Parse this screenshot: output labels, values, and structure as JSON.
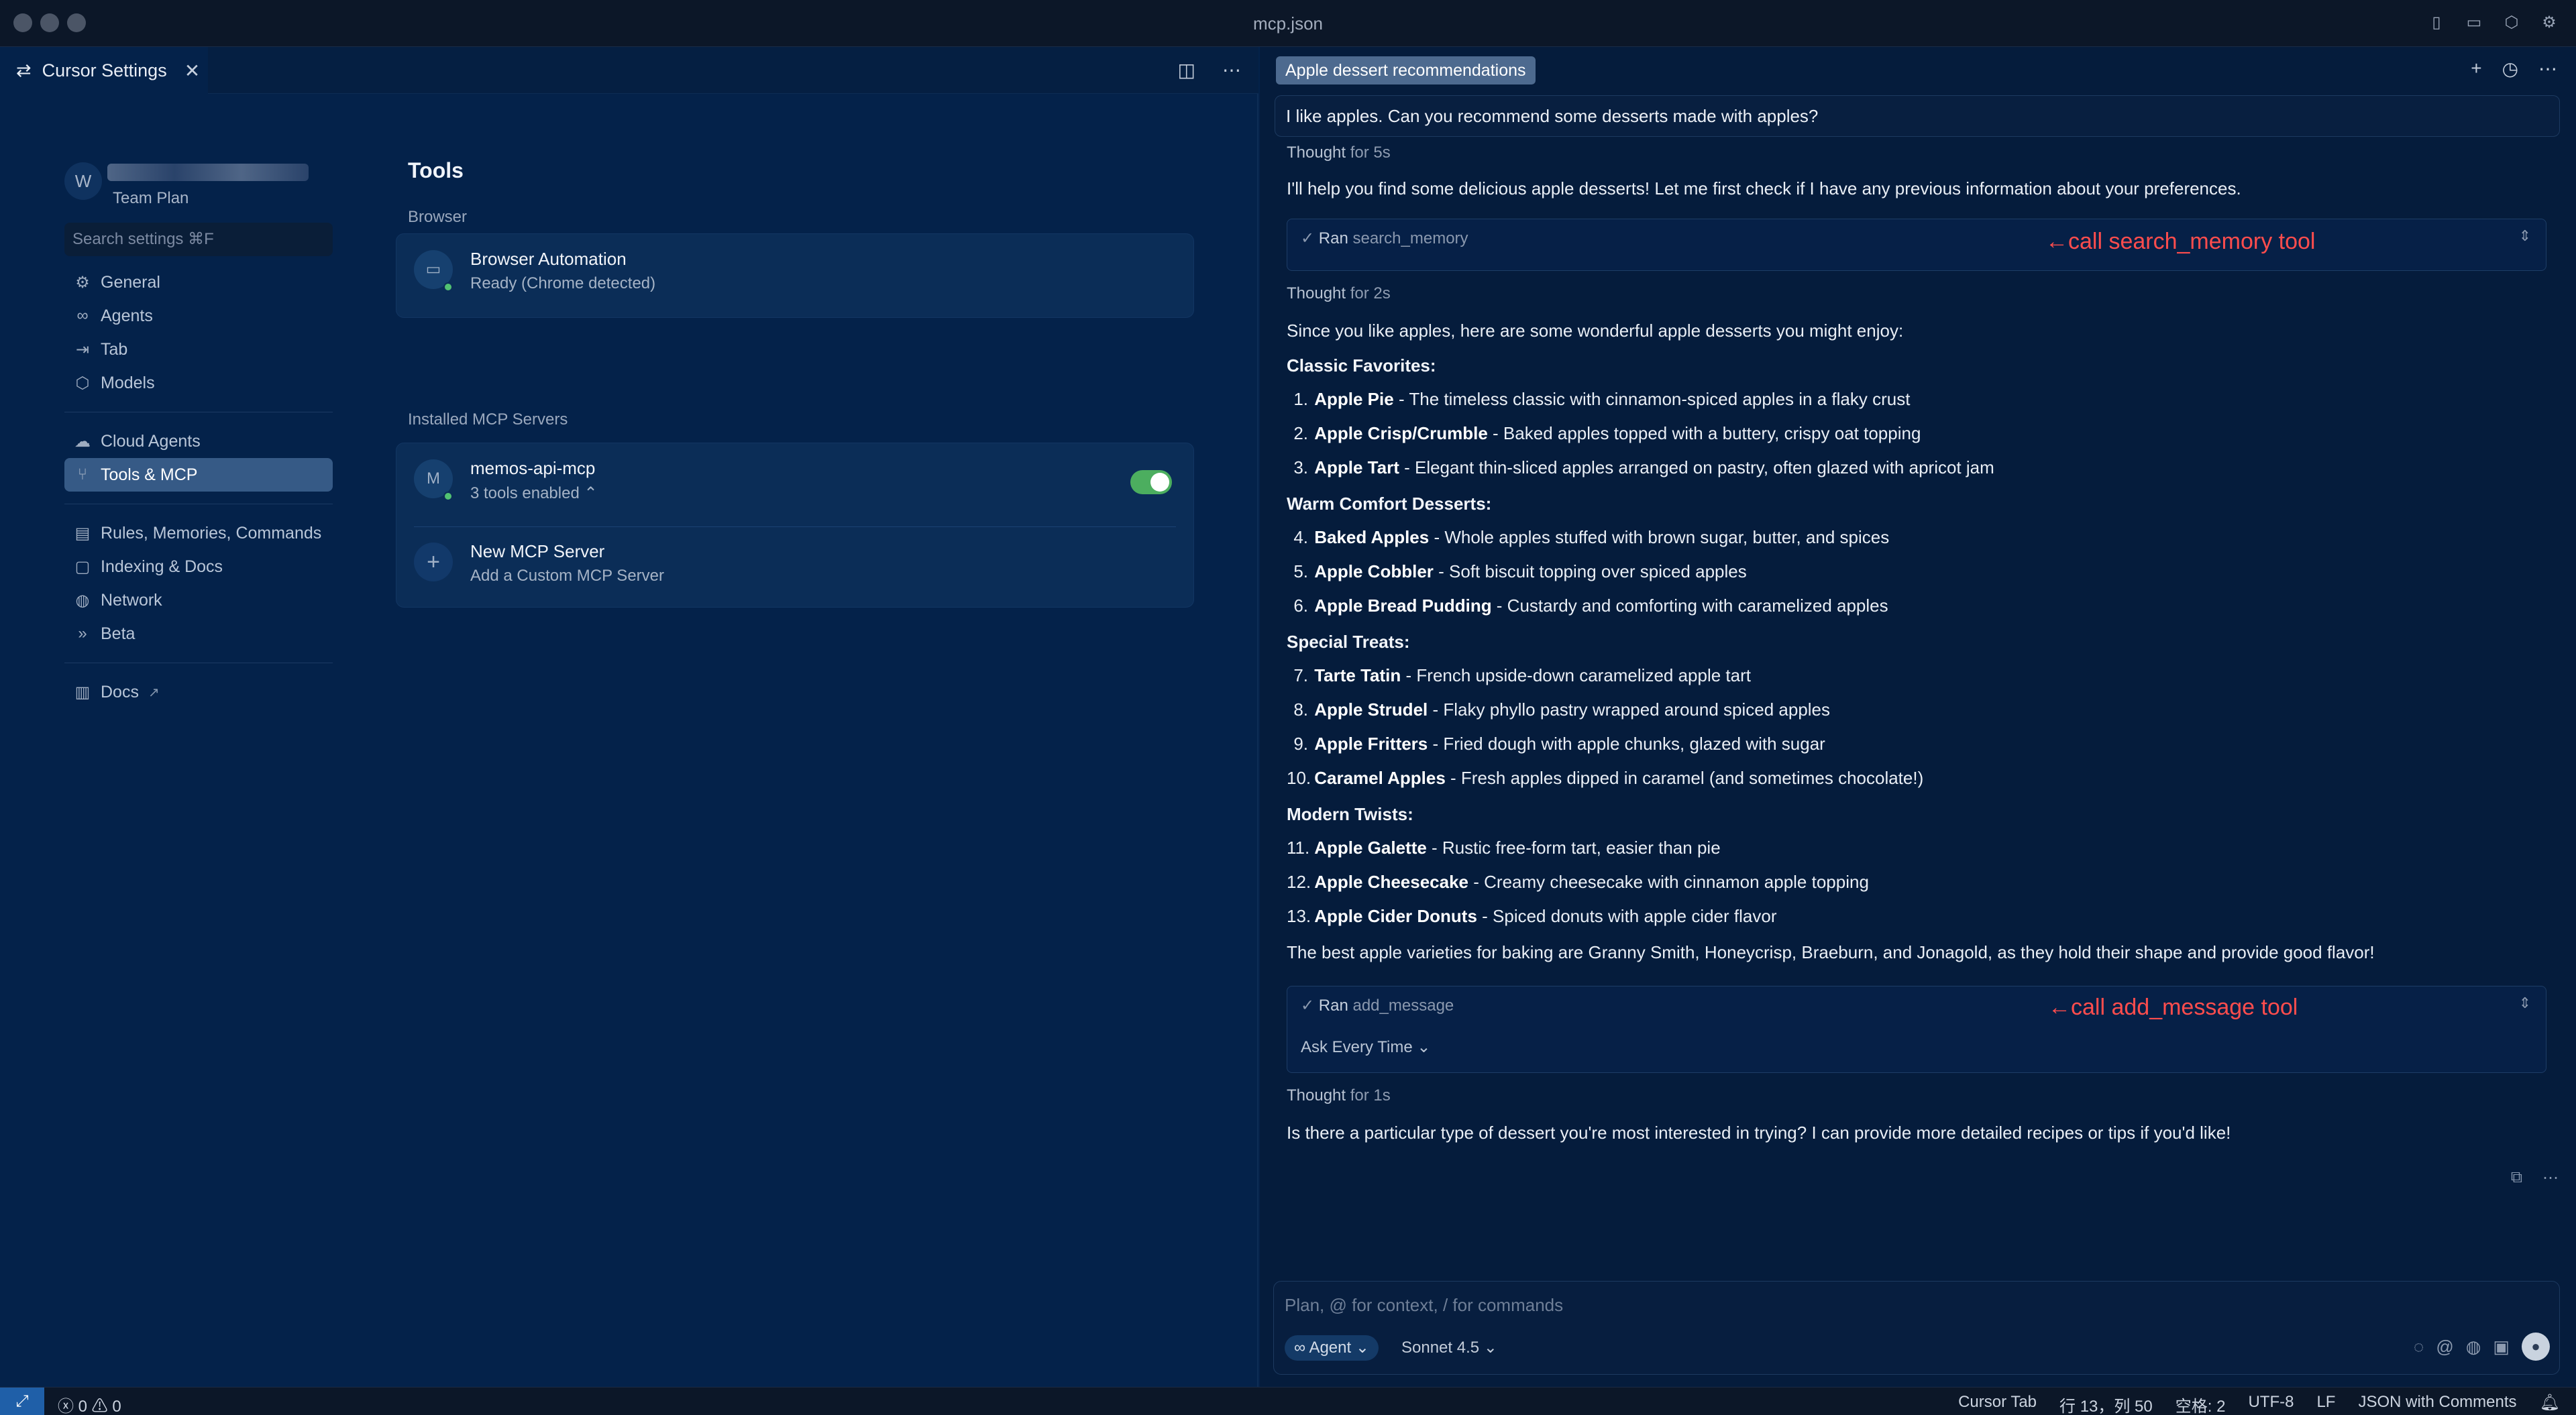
{
  "window": {
    "title": "mcp.json"
  },
  "left_tab": {
    "title": "Cursor Settings"
  },
  "user": {
    "initial": "W",
    "plan": "Team Plan"
  },
  "search": {
    "placeholder": "Search settings ⌘F"
  },
  "nav": {
    "group1": [
      "General",
      "Agents",
      "Tab",
      "Models"
    ],
    "group2": [
      "Cloud Agents",
      "Tools & MCP"
    ],
    "group3": [
      "Rules, Memories, Commands",
      "Indexing & Docs",
      "Network",
      "Beta"
    ],
    "group4": [
      "Docs"
    ]
  },
  "tools": {
    "title": "Tools",
    "browser_label": "Browser",
    "browser": {
      "name": "Browser Automation",
      "status": "Ready (Chrome detected)"
    },
    "installed_label": "Installed MCP Servers",
    "server": {
      "initial": "M",
      "name": "memos-api-mcp",
      "status": "3 tools enabled",
      "enabled": true
    },
    "new_server": {
      "name": "New MCP Server",
      "sub": "Add a Custom MCP Server"
    }
  },
  "chat": {
    "tab_title": "Apple dessert recommendations",
    "user_message": "I like apples. Can you recommend some desserts made with apples?",
    "thought1": {
      "label": "Thought",
      "time": "for 5s"
    },
    "intro": "I'll help you find some delicious apple desserts! Let me first check if I have any previous information about your preferences.",
    "tool1": {
      "ran": "Ran",
      "name": "search_memory",
      "annotation": "←call search_memory tool"
    },
    "thought2": {
      "label": "Thought",
      "time": "for 2s"
    },
    "lead": "Since you like apples, here are some wonderful apple desserts you might enjoy:",
    "sections": [
      {
        "heading": "Classic Favorites:",
        "items": [
          {
            "n": "1.",
            "name": "Apple Pie",
            "desc": " - The timeless classic with cinnamon-spiced apples in a flaky crust"
          },
          {
            "n": "2.",
            "name": "Apple Crisp/Crumble",
            "desc": " - Baked apples topped with a buttery, crispy oat topping"
          },
          {
            "n": "3.",
            "name": "Apple Tart",
            "desc": " - Elegant thin-sliced apples arranged on pastry, often glazed with apricot jam"
          }
        ]
      },
      {
        "heading": "Warm Comfort Desserts:",
        "items": [
          {
            "n": "4.",
            "name": "Baked Apples",
            "desc": " - Whole apples stuffed with brown sugar, butter, and spices"
          },
          {
            "n": "5.",
            "name": "Apple Cobbler",
            "desc": " - Soft biscuit topping over spiced apples"
          },
          {
            "n": "6.",
            "name": "Apple Bread Pudding",
            "desc": " - Custardy and comforting with caramelized apples"
          }
        ]
      },
      {
        "heading": "Special Treats:",
        "items": [
          {
            "n": "7.",
            "name": "Tarte Tatin",
            "desc": " - French upside-down caramelized apple tart"
          },
          {
            "n": "8.",
            "name": "Apple Strudel",
            "desc": " - Flaky phyllo pastry wrapped around spiced apples"
          },
          {
            "n": "9.",
            "name": "Apple Fritters",
            "desc": " - Fried dough with apple chunks, glazed with sugar"
          },
          {
            "n": "10.",
            "name": "Caramel Apples",
            "desc": " - Fresh apples dipped in caramel (and sometimes chocolate!)"
          }
        ]
      },
      {
        "heading": "Modern Twists:",
        "items": [
          {
            "n": "11.",
            "name": "Apple Galette",
            "desc": " - Rustic free-form tart, easier than pie"
          },
          {
            "n": "12.",
            "name": "Apple Cheesecake",
            "desc": " - Creamy cheesecake with cinnamon apple topping"
          },
          {
            "n": "13.",
            "name": "Apple Cider Donuts",
            "desc": " - Spiced donuts with apple cider flavor"
          }
        ]
      }
    ],
    "varieties": "The best apple varieties for baking are Granny Smith, Honeycrisp, Braeburn, and Jonagold, as they hold their shape and provide good flavor!",
    "tool2": {
      "ran": "Ran",
      "name": "add_message",
      "annotation": "←call add_message tool",
      "permission": "Ask Every Time"
    },
    "thought3": {
      "label": "Thought",
      "time": "for 1s"
    },
    "closing": "Is there a particular type of dessert you're most interested in trying? I can provide more detailed recipes or tips if you'd like!",
    "composer": {
      "placeholder": "Plan, @ for context, / for commands",
      "mode": "Agent",
      "model": "Sonnet 4.5"
    }
  },
  "statusbar": {
    "problems": "ⓧ 0 ⚠ 0",
    "cursor_tab": "Cursor Tab",
    "position": "行 13，列 50",
    "spaces": "空格: 2",
    "encoding": "UTF-8",
    "eol": "LF",
    "language": "JSON with Comments"
  },
  "colors": {
    "annotation": "#ff4d4d",
    "toggle_on": "#4cae5f",
    "active_nav": "#365a86"
  }
}
